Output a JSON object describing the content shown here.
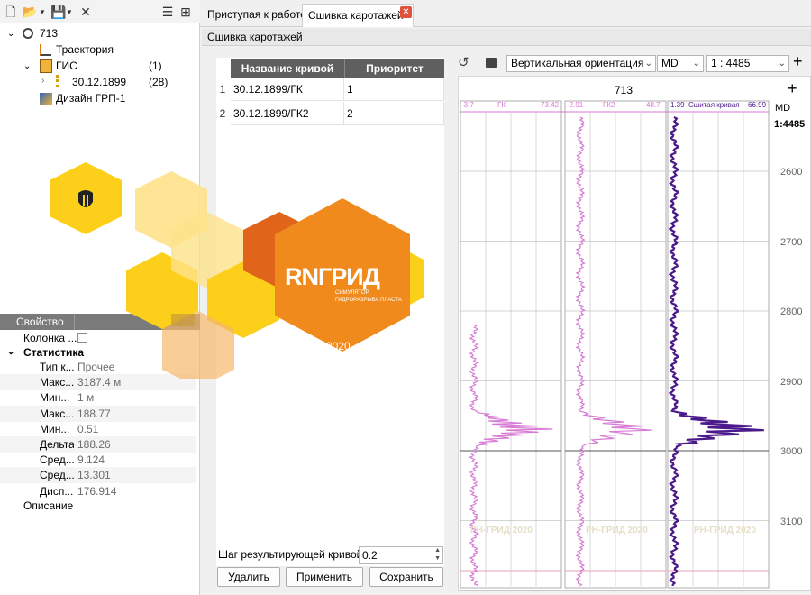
{
  "left_panel": {
    "tree": [
      {
        "label": "713",
        "count": ""
      },
      {
        "label": "Траектория",
        "count": ""
      },
      {
        "label": "ГИС",
        "count": "(1)"
      },
      {
        "label": "30.12.1899",
        "count": "(28)"
      },
      {
        "label": "Дизайн ГРП-1",
        "count": ""
      }
    ]
  },
  "properties": {
    "header": "Свойство",
    "column_row": "Колонка ...",
    "section": "Статистика",
    "rows": [
      {
        "label": "Тип к...",
        "value": "Прочее"
      },
      {
        "label": "Макс...",
        "value": "3187.4 м"
      },
      {
        "label": "Мин...",
        "value": "1 м"
      },
      {
        "label": "Макс...",
        "value": "188.77"
      },
      {
        "label": "Мин...",
        "value": "0.51"
      },
      {
        "label": "Дельта",
        "value": "188.26"
      },
      {
        "label": "Сред...",
        "value": "9.124"
      },
      {
        "label": "Сред...",
        "value": "13.301"
      },
      {
        "label": "Дисп...",
        "value": "176.914"
      }
    ],
    "footer": "Описание"
  },
  "tabs": {
    "welcome": "Приступая к работе",
    "splice": "Сшивка каротажей",
    "close": "✕"
  },
  "subheader": "Сшивка каротажей",
  "table": {
    "col_name": "Название кривой",
    "col_priority": "Приоритет",
    "rows": [
      {
        "num": "1",
        "name": "30.12.1899/ГК",
        "priority": "1"
      },
      {
        "num": "2",
        "name": "30.12.1899/ГК2",
        "priority": "2"
      }
    ]
  },
  "controls": {
    "step_label": "Шаг результирующей кривой",
    "step_value": "0.2",
    "delete": "Удалить",
    "apply": "Применить",
    "save": "Сохранить"
  },
  "log_toolbar": {
    "orientation": "Вертикальная ориентация",
    "depth_type": "MD",
    "scale": "1 : 4485"
  },
  "log_view": {
    "well": "713",
    "depth_label": "MD",
    "scale_label": "1:4485",
    "tracks": [
      {
        "min": "-3.7",
        "name": "ГК",
        "max": "73.42",
        "color": "#d77ad4"
      },
      {
        "min": "-2.91",
        "name": "ГК2",
        "max": "48.7",
        "color": "#d77ad4"
      },
      {
        "min": "1.39",
        "name": "Сшитая кривая",
        "max": "66.99",
        "color": "#4b1a8a"
      }
    ],
    "depths": [
      "2600",
      "2700",
      "2800",
      "2900",
      "3000",
      "3100"
    ],
    "watermark": "РН-ГРИД 2020"
  },
  "splash": {
    "logo": "RNГРИД",
    "subtitle_1": "СИМУЛЯТОР",
    "subtitle_2": "ГИДРОРАЗРЫВА ПЛАСТА",
    "year": "2020"
  },
  "colors": {
    "orange": "#f08a1c",
    "dark_orange": "#e0641a",
    "yellow": "#fcd01a",
    "curve_pink": "#d77ad4",
    "curve_purple": "#4b1a8a"
  }
}
